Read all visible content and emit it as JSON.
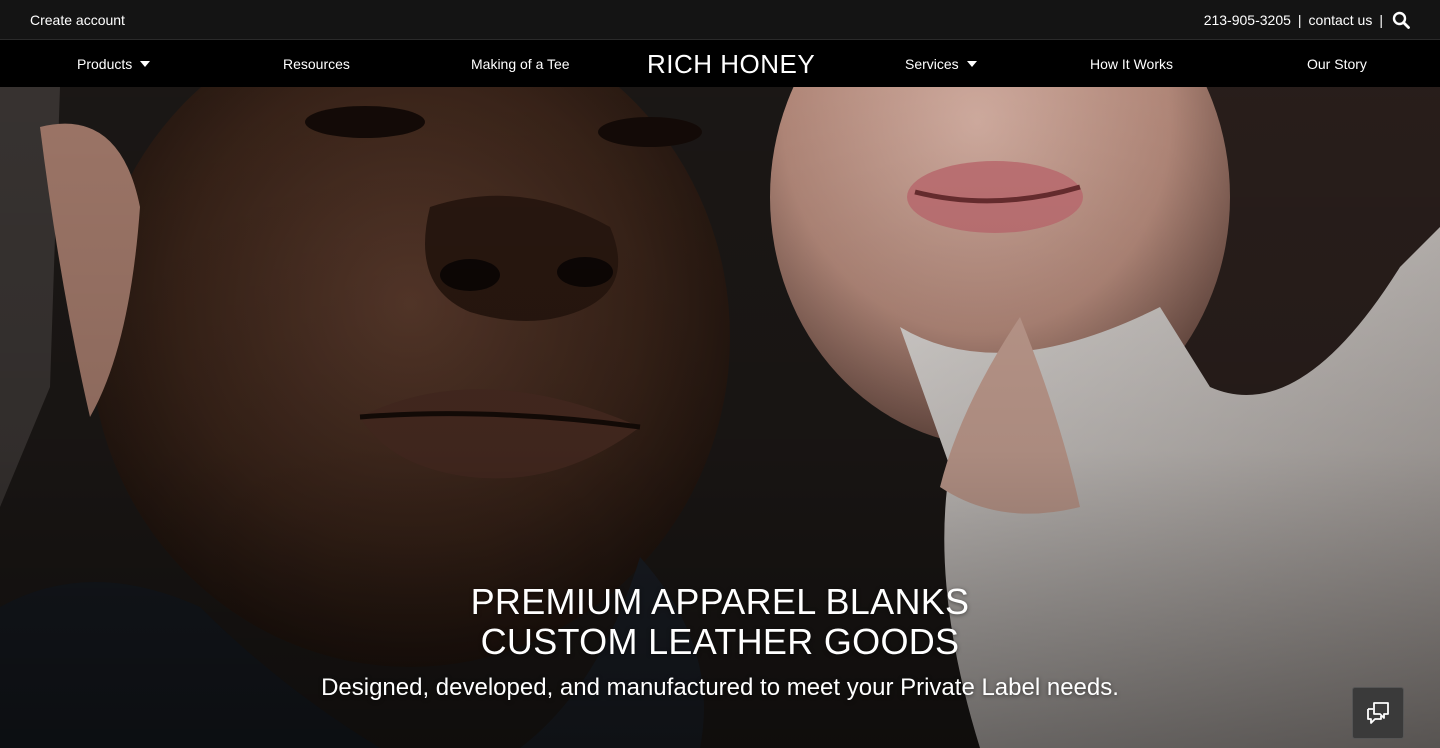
{
  "topbar": {
    "create_account": "Create account",
    "phone": "213-905-3205",
    "separator": "|",
    "contact": "contact us"
  },
  "nav": {
    "products": "Products",
    "resources": "Resources",
    "making": "Making of a Tee",
    "brand": "RICH HONEY",
    "services": "Services",
    "how": "How It Works",
    "story": "Our Story"
  },
  "hero": {
    "title_line1": "PREMIUM APPAREL BLANKS",
    "title_line2": "CUSTOM LEATHER GOODS",
    "subtitle": "Designed, developed, and manufactured to meet your Private Label needs."
  },
  "icons": {
    "search": "search-icon",
    "caret": "chevron-down-icon",
    "chat": "chat-icon"
  },
  "colors": {
    "topbar_bg": "#141414",
    "nav_bg": "#000000",
    "text": "#ffffff"
  }
}
